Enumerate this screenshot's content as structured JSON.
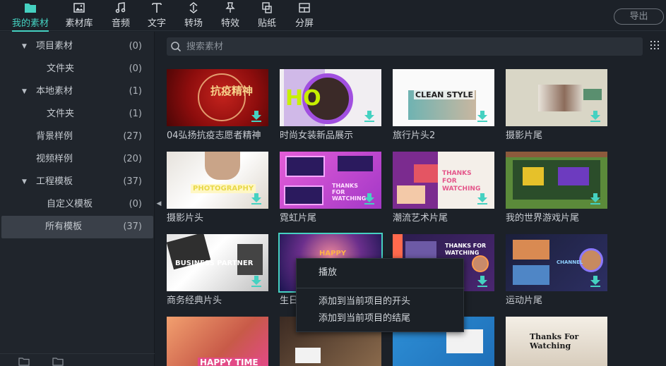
{
  "toolbar": {
    "tabs": [
      {
        "label": "我的素材",
        "icon": "folder-icon",
        "active": true
      },
      {
        "label": "素材库",
        "icon": "image-library-icon"
      },
      {
        "label": "音频",
        "icon": "music-note-icon"
      },
      {
        "label": "文字",
        "icon": "text-icon"
      },
      {
        "label": "转场",
        "icon": "transition-icon"
      },
      {
        "label": "特效",
        "icon": "effects-pin-icon"
      },
      {
        "label": "贴纸",
        "icon": "sticker-icon"
      },
      {
        "label": "分屏",
        "icon": "split-screen-icon"
      }
    ],
    "export_label": "导出"
  },
  "sidebar": {
    "items": [
      {
        "label": "项目素材",
        "count": "(0)",
        "expanded": true
      },
      {
        "label": "文件夹",
        "count": "(0)"
      },
      {
        "label": "本地素材",
        "count": "(1)",
        "expanded": true
      },
      {
        "label": "文件夹",
        "count": "(1)"
      },
      {
        "label": "背景样例",
        "count": "(27)"
      },
      {
        "label": "视频样例",
        "count": "(20)"
      },
      {
        "label": "工程模板",
        "count": "(37)",
        "expanded": true
      },
      {
        "label": "自定义模板",
        "count": "(0)"
      },
      {
        "label": "所有模板",
        "count": "(37)",
        "selected": true
      }
    ]
  },
  "search": {
    "placeholder": "搜索素材",
    "value": ""
  },
  "cards": [
    {
      "title": "04弘扬抗疫志愿者精神",
      "thumb_text": "抗疫精神"
    },
    {
      "title": "时尚女装新品展示",
      "thumb_text": "HO"
    },
    {
      "title": "旅行片头2",
      "thumb_text": "CLEAN STYLE"
    },
    {
      "title": "摄影片尾",
      "thumb_text": ""
    },
    {
      "title": "摄影片头",
      "thumb_text": "PHOTOGRAPHY"
    },
    {
      "title": "霓虹片尾",
      "thumb_text": "THANKS FOR WATCHING"
    },
    {
      "title": "潮流艺术片尾",
      "thumb_text": "THANKS FOR WATCHING"
    },
    {
      "title": "我的世界游戏片尾",
      "thumb_text": ""
    },
    {
      "title": "商务经典片头",
      "thumb_text": "BUSINESS PARTNER"
    },
    {
      "title": "生日",
      "thumb_text": "HAPPY"
    },
    {
      "title": "",
      "thumb_text": "THANKS FOR WATCHING"
    },
    {
      "title": "运动片尾",
      "thumb_text": "CHANNEL"
    },
    {
      "title": "",
      "thumb_text": "HAPPY TIME"
    },
    {
      "title": "",
      "thumb_text": ""
    },
    {
      "title": "",
      "thumb_text": ""
    },
    {
      "title": "",
      "thumb_text": "Thanks For Watching"
    }
  ],
  "context_menu": {
    "items": [
      "播放",
      "添加到当前项目的开头",
      "添加到当前项目的结尾"
    ]
  },
  "colors": {
    "accent": "#45d1c1",
    "background": "#1c2128",
    "sidebar": "#20252c"
  }
}
